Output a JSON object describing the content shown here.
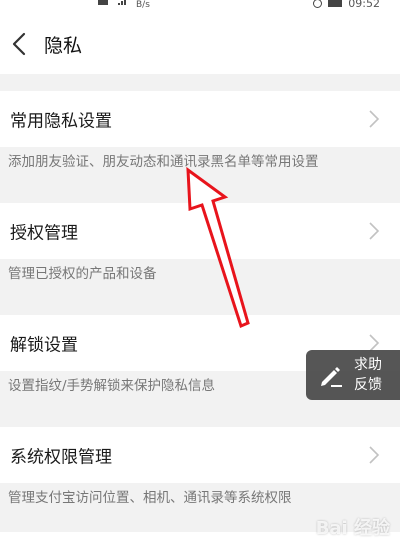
{
  "status_bar": {
    "speed_unit": "B/s",
    "time": "09:52"
  },
  "header": {
    "title": "隐私"
  },
  "sections": [
    {
      "label": "常用隐私设置",
      "description": "添加朋友验证、朋友动态和通讯录黑名单等常用设置"
    },
    {
      "label": "授权管理",
      "description": "管理已授权的产品和设备"
    },
    {
      "label": "解锁设置",
      "description": "设置指纹/手势解锁来保护隐私信息"
    },
    {
      "label": "系统权限管理",
      "description": "管理支付宝访问位置、相机、通讯录等系统权限"
    }
  ],
  "help_button": {
    "line1": "求助",
    "line2": "反馈"
  },
  "watermark": "Bai 经验",
  "colors": {
    "annotation_arrow": "#e8141c",
    "help_bg": "#484848"
  }
}
